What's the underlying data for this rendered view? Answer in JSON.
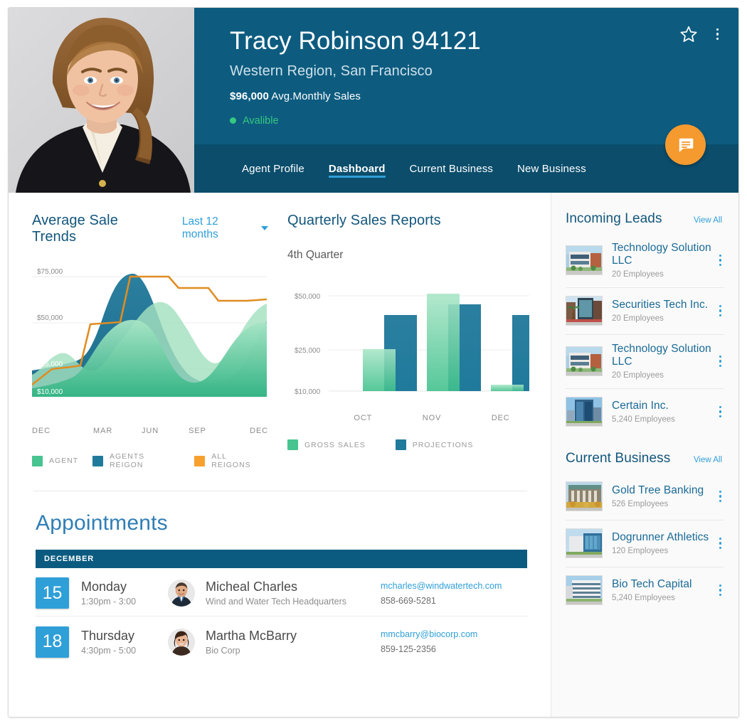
{
  "header": {
    "agent_name": "Tracy Robinson 94121",
    "region": "Western Region, San Francisco",
    "sales_amount": "$96,000",
    "sales_label": " Avg.Monthly Sales",
    "status": "Avalible",
    "star_icon": "star-icon",
    "more_icon": "more-vertical-icon",
    "chat_icon": "chat-bubble-icon",
    "accent_blue": "#0d5c80",
    "tabs_bg": "#0b4d6b",
    "status_green": "#35c87f",
    "fab_orange": "#f59a2e"
  },
  "tabs": [
    {
      "label": "Agent Profile",
      "active": false
    },
    {
      "label": "Dashboard",
      "active": true
    },
    {
      "label": "Current Business",
      "active": false
    },
    {
      "label": "New Business",
      "active": false
    }
  ],
  "area_panel": {
    "title": "Average Sale Trends",
    "dropdown_value": "Last 12 months",
    "dropdown_icon": "chevron-down-icon"
  },
  "bar_panel": {
    "title": "Quarterly Sales Reports",
    "subtitle": "4th Quarter"
  },
  "chart_data": [
    {
      "type": "area",
      "title": "Average Sale Trends",
      "xlabel": "",
      "ylabel": "",
      "ylim": [
        0,
        80000
      ],
      "ytick_labels": [
        "$75,000",
        "$50,000",
        "$25,000",
        "$10,000"
      ],
      "ytick_values": [
        75000,
        50000,
        25000,
        10000
      ],
      "xtick_labels": [
        "DEC",
        "MAR",
        "JUN",
        "SEP",
        "DEC"
      ],
      "grid": true,
      "legend_position": "bottom",
      "series": [
        {
          "name": "AGENT",
          "color": "#3fc08b",
          "values": [
            18000,
            22000,
            34000,
            26000,
            30000,
            46000,
            60000,
            62000,
            55000,
            44000,
            48000,
            57000,
            60000
          ]
        },
        {
          "name": "AGENTS REIGON",
          "color": "#1f7a9c",
          "values": [
            14000,
            16000,
            20000,
            27000,
            52000,
            72000,
            74000,
            46000,
            30000,
            24000,
            26000,
            40000,
            67000
          ]
        },
        {
          "name": "ALL REIGONS",
          "color": "#e89a2b",
          "values": [
            17000,
            24000,
            25500,
            26000,
            49000,
            49500,
            72000,
            72000,
            72000,
            64000,
            64000,
            57000,
            57500
          ]
        }
      ]
    },
    {
      "type": "bar",
      "title": "Quarterly Sales Reports",
      "subtitle": "4th Quarter",
      "categories": [
        "OCT",
        "NOV",
        "DEC"
      ],
      "xlabel": "",
      "ylabel": "",
      "ylim": [
        5000,
        57000
      ],
      "ytick_labels": [
        "$50,000",
        "$25,000",
        "$10,000"
      ],
      "ytick_values": [
        50000,
        25000,
        10000
      ],
      "grid": true,
      "legend_position": "bottom",
      "series": [
        {
          "name": "GROSS SALES",
          "color": "#3fc08b",
          "values": [
            24000,
            50000,
            11000
          ]
        },
        {
          "name": "PROJECTIONS",
          "color": "#1f7a9c",
          "values": [
            37000,
            44500,
            37000
          ]
        }
      ]
    }
  ],
  "appointments": {
    "title": "Appointments",
    "month": "DECEMBER",
    "rows": [
      {
        "day": "15",
        "weekday": "Monday",
        "time": "1:30pm - 3:00",
        "name": "Micheal Charles",
        "org": "Wind and Water Tech Headquarters",
        "email": "mcharles@windwatertech.com",
        "phone": "858-669-5281",
        "avatar": "avatar-male"
      },
      {
        "day": "18",
        "weekday": "Thursday",
        "time": "4:30pm - 5:00",
        "name": "Martha McBarry",
        "org": "Bio Corp",
        "email": "mmcbarry@biocorp.com",
        "phone": "859-125-2356",
        "avatar": "avatar-female"
      }
    ]
  },
  "incoming_leads": {
    "title": "Incoming Leads",
    "view_all": "View All",
    "items": [
      {
        "name": "Technology Solution LLC",
        "employees": "20 Employees",
        "thumb": "building-low-rise"
      },
      {
        "name": "Securities Tech Inc.",
        "employees": "20 Employees",
        "thumb": "building-glass-palms"
      },
      {
        "name": "Technology Solution LLC",
        "employees": "20 Employees",
        "thumb": "building-low-rise"
      },
      {
        "name": "Certain Inc.",
        "employees": "5,240 Employees",
        "thumb": "building-blue-tower"
      }
    ]
  },
  "current_business": {
    "title": "Current Business",
    "view_all": "View All",
    "items": [
      {
        "name": "Gold Tree Banking",
        "employees": "526 Employees",
        "thumb": "building-stone-columns"
      },
      {
        "name": "Dogrunner Athletics",
        "employees": "120 Employees",
        "thumb": "building-blue-glass"
      },
      {
        "name": "Bio Tech Capital",
        "employees": "5,240 Employees",
        "thumb": "building-white-modern"
      }
    ]
  }
}
